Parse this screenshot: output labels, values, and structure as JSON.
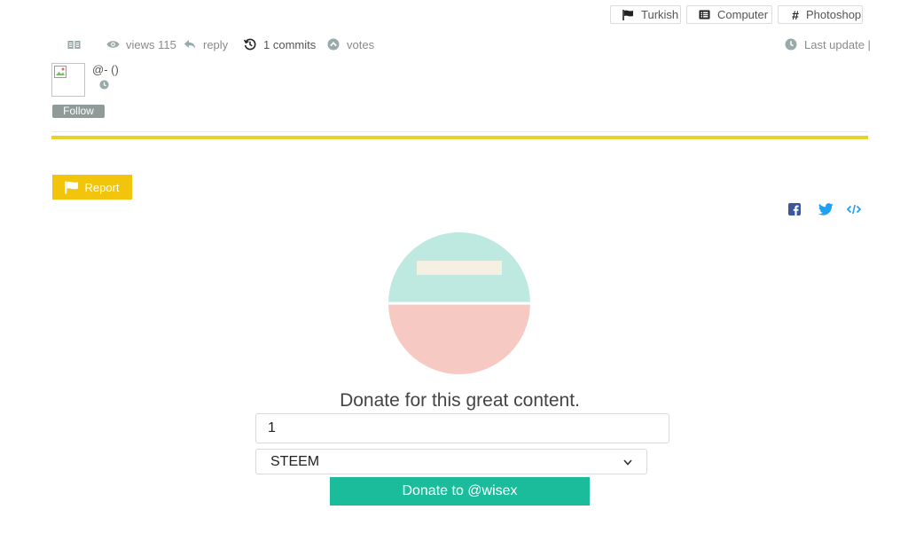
{
  "tags": [
    {
      "icon": "flag-icon",
      "label": "Turkish"
    },
    {
      "icon": "list-icon",
      "label": "Computer"
    },
    {
      "icon": "hash-icon",
      "label": "Photoshop"
    }
  ],
  "meta": {
    "views": "views 115",
    "reply": "reply",
    "commits": "1 commits",
    "votes": "votes",
    "last_update": "Last update |"
  },
  "author": {
    "handle": "@- ()",
    "follow_label": "Follow"
  },
  "report_label": "Report",
  "share": [
    "facebook-icon",
    "twitter-icon",
    "embed-code-icon"
  ],
  "donate": {
    "title": "Donate for this great content.",
    "amount": "1",
    "currency": "STEEM",
    "button_label": "Donate to @wisex"
  },
  "colors": {
    "accent_yellow": "#e6d22a",
    "report_bg": "#f2c50c",
    "donate_green": "#1abc9c",
    "hero_top": "#bde9e0",
    "hero_bottom": "#f7c9c3",
    "share_blue": "#1da1f2",
    "facebook_blue": "#3b5998"
  }
}
